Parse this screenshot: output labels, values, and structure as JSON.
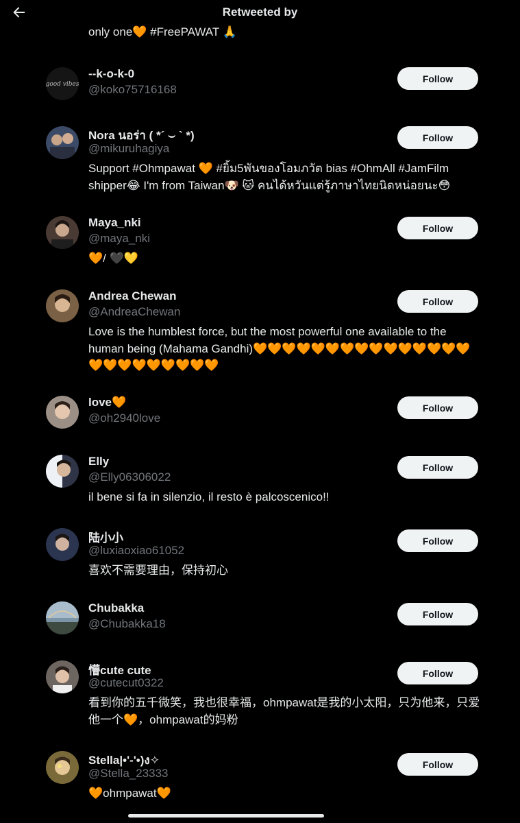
{
  "header": {
    "title": "Retweeted by"
  },
  "partial_text": "only one🧡 #FreePAWAT 🙏",
  "users": [
    {
      "name": "--k-o-k-0",
      "handle": "@koko75716168",
      "bio": "",
      "follow_label": "Follow",
      "avatar_color": "#151515"
    },
    {
      "name": "Nora นอร่า ( *´ ⌣ ` *)",
      "handle": "@mikuruhagiya",
      "bio": "Support #Ohmpawat 🧡 #ยิ้ม5พันของโอมภวัต bias #OhmAll #JamFilm shipper😂 I'm from Taiwan🐶 🐱 คนได้หวันแต่รู้ภาษาไทยนิดหน่อยนะ😳",
      "follow_label": "Follow",
      "avatar_color": "#3b4a66"
    },
    {
      "name": "Maya_nki",
      "handle": "@maya_nki",
      "bio": "🧡/ 🖤💛",
      "follow_label": "Follow",
      "avatar_color": "#4a3a34"
    },
    {
      "name": "Andrea Chewan",
      "handle": "@AndreaChewan",
      "bio": "Love is the humblest force, but the most powerful one available to the human being (Mahama Gandhi)🧡🧡🧡🧡🧡🧡🧡🧡🧡🧡🧡🧡🧡🧡🧡🧡🧡🧡🧡🧡🧡🧡🧡🧡",
      "follow_label": "Follow",
      "avatar_color": "#7a6044"
    },
    {
      "name": "love🧡",
      "handle": "@oh2940love",
      "bio": "",
      "follow_label": "Follow",
      "avatar_color": "#9b8f86"
    },
    {
      "name": "Elly",
      "handle": "@Elly06306022",
      "bio": "il bene si fa in silenzio, il resto è palcoscenico!!",
      "follow_label": "Follow",
      "avatar_color": "#2f3546"
    },
    {
      "name": "陆小小",
      "handle": "@luxiaoxiao61052",
      "bio": "喜欢不需要理由，保持初心",
      "follow_label": "Follow",
      "avatar_color": "#2b3550"
    },
    {
      "name": "Chubakka",
      "handle": "@Chubakka18",
      "bio": "",
      "follow_label": "Follow",
      "avatar_color": "#7d93a6"
    },
    {
      "name": "懵cute cute",
      "handle": "@cutecut0322",
      "bio": "看到你的五千微笑，我也很幸福，ohmpawat是我的小太阳，只为他来，只爱他一个🧡，ohmpawat的妈粉",
      "follow_label": "Follow",
      "avatar_color": "#6d6560"
    },
    {
      "name": "Stella|•'-'•)ง✧",
      "handle": "@Stella_23333",
      "bio": "🧡ohmpawat🧡",
      "follow_label": "Follow",
      "avatar_color": "#7a6a3a"
    }
  ],
  "colors": {
    "background": "#000000",
    "text": "#e7e9ea",
    "secondary": "#71767b",
    "button_bg": "#eff3f4",
    "button_text": "#0f1419"
  }
}
